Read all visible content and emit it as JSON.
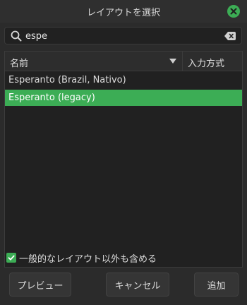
{
  "window": {
    "title": "レイアウトを選択",
    "close_icon": "close-icon",
    "accent_color": "#3cad55"
  },
  "search": {
    "value": "espe",
    "icon": "search-icon",
    "clear_icon": "clear-icon"
  },
  "list": {
    "columns": {
      "name": "名前",
      "method": "入力方式"
    },
    "rows": [
      {
        "label": "Esperanto (Brazil, Nativo)",
        "selected": false
      },
      {
        "label": "Esperanto (legacy)",
        "selected": true
      }
    ]
  },
  "option": {
    "checked": true,
    "label": "一般的なレイアウト以外も含める"
  },
  "buttons": {
    "preview": "プレビュー",
    "cancel": "キャンセル",
    "add": "追加"
  }
}
